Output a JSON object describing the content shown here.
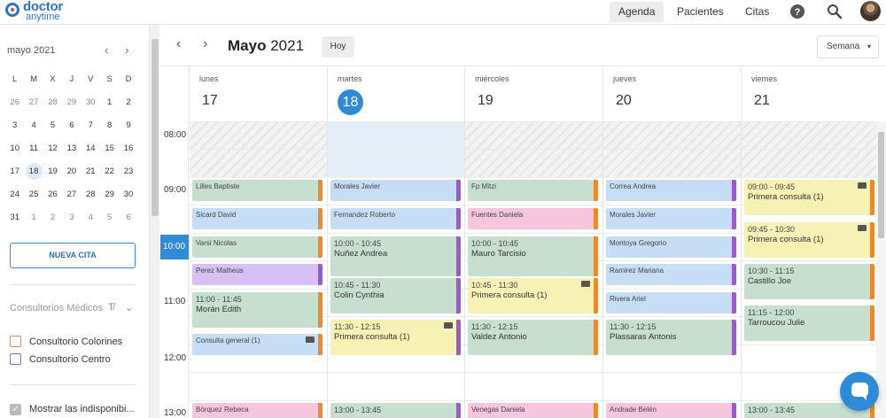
{
  "brand": {
    "line1": "doctor",
    "line2": "anytime"
  },
  "nav": [
    {
      "label": "Agenda",
      "active": true
    },
    {
      "label": "Pacientes",
      "active": false
    },
    {
      "label": "Citas",
      "active": false
    }
  ],
  "top_icons": [
    "help-icon",
    "search-icon",
    "user-avatar"
  ],
  "mini_calendar": {
    "title": "mayo 2021",
    "weekdays": [
      "L",
      "M",
      "X",
      "J",
      "V",
      "S",
      "D"
    ],
    "weeks": [
      [
        "26",
        "27",
        "28",
        "29",
        "30",
        "1",
        "2"
      ],
      [
        "3",
        "4",
        "5",
        "6",
        "7",
        "8",
        "9"
      ],
      [
        "10",
        "11",
        "12",
        "13",
        "14",
        "15",
        "16"
      ],
      [
        "17",
        "18",
        "19",
        "20",
        "21",
        "22",
        "23"
      ],
      [
        "24",
        "25",
        "26",
        "27",
        "28",
        "29",
        "30"
      ],
      [
        "31",
        "1",
        "2",
        "3",
        "4",
        "5",
        "6"
      ]
    ],
    "selected": "18"
  },
  "sidebar": {
    "new_button": "NUEVA CITA",
    "section_title": "Consultorios Médicos",
    "offices": [
      {
        "label": "Consultorio Colorines",
        "color": "#e88a2e"
      },
      {
        "label": "Consultorio Centro",
        "color": "#9a5ac8"
      }
    ],
    "show_unavailable": "Mostrar las indisponibi..."
  },
  "header": {
    "month": "Mayo",
    "year": "2021",
    "today_button": "Hoy",
    "view_select": "Semana"
  },
  "days": [
    {
      "name": "lunes",
      "num": "17",
      "today": false
    },
    {
      "name": "martes",
      "num": "18",
      "today": true
    },
    {
      "name": "miércoles",
      "num": "19",
      "today": false
    },
    {
      "name": "jueves",
      "num": "20",
      "today": false
    },
    {
      "name": "viernes",
      "num": "21",
      "today": false
    }
  ],
  "times": [
    "08:00",
    "09:00",
    "10:00",
    "11:00",
    "12:00",
    "13:00"
  ],
  "current_time_label": "10:00",
  "colors": {
    "green": "#c6dfcf",
    "blue": "#c6def5",
    "purple": "#d8c0f3",
    "pink": "#f6c5de",
    "yellow": "#f7f1b6",
    "orange_strip": "#e88a2e",
    "purple_strip": "#9a5ac8",
    "accent": "#2f8bd6"
  },
  "events": [
    {
      "day": 0,
      "t1": "Lilles Baptiste",
      "t2": "",
      "color": "green",
      "strip": "orange_strip"
    },
    {
      "day": 0,
      "t1": "Sicard David",
      "t2": "",
      "color": "blue",
      "strip": "orange_strip"
    },
    {
      "day": 0,
      "t1": "Varsi Nicolas",
      "t2": "",
      "color": "green",
      "strip": "orange_strip"
    },
    {
      "day": 0,
      "t1": "Perez Matheus",
      "t2": "",
      "color": "purple",
      "strip": "purple_strip"
    },
    {
      "day": 0,
      "t1": "11:00 - 11:45",
      "t2": "Morán Edith",
      "color": "green",
      "strip": "orange_strip",
      "big": true
    },
    {
      "day": 0,
      "t1": "Consulta general (1)",
      "t2": "",
      "color": "blue",
      "strip": "orange_strip",
      "mail": true
    },
    {
      "day": 0,
      "t1": "Bórquez Rebeca",
      "t2": "",
      "color": "pink",
      "strip": "orange_strip"
    },
    {
      "day": 1,
      "t1": "Morales Javier",
      "t2": "",
      "color": "blue",
      "strip": "purple_strip"
    },
    {
      "day": 1,
      "t1": "Fernandez Roberto",
      "t2": "",
      "color": "blue",
      "strip": "purple_strip"
    },
    {
      "day": 1,
      "t1": "10:00 - 10:45",
      "t2": "Nuñez Andrea",
      "color": "green",
      "strip": "purple_strip",
      "big": true
    },
    {
      "day": 1,
      "t1": "10:45 - 11:30",
      "t2": "Colin Cynthia",
      "color": "green",
      "strip": "purple_strip",
      "big": true
    },
    {
      "day": 1,
      "t1": "11:30 - 12:15",
      "t2": "Primera consulta (1)",
      "color": "yellow",
      "strip": "purple_strip",
      "big": true,
      "mail": true
    },
    {
      "day": 1,
      "t1": "13:00 - 13:45",
      "t2": "",
      "color": "green",
      "strip": "purple_strip",
      "big": true
    },
    {
      "day": 2,
      "t1": "Fp Mitzi",
      "t2": "",
      "color": "green",
      "strip": "orange_strip"
    },
    {
      "day": 2,
      "t1": "Fuentes Daniela",
      "t2": "",
      "color": "pink",
      "strip": "orange_strip"
    },
    {
      "day": 2,
      "t1": "10:00 - 10:45",
      "t2": "Mauro Tarcisio",
      "color": "green",
      "strip": "orange_strip",
      "big": true
    },
    {
      "day": 2,
      "t1": "10:45 - 11:30",
      "t2": "Primera consulta (1)",
      "color": "yellow",
      "strip": "orange_strip",
      "big": true,
      "mail": true
    },
    {
      "day": 2,
      "t1": "11:30 - 12:15",
      "t2": "Valdez Antonio",
      "color": "green",
      "strip": "orange_strip",
      "big": true
    },
    {
      "day": 2,
      "t1": "Venegas Daniela",
      "t2": "",
      "color": "pink",
      "strip": "orange_strip"
    },
    {
      "day": 3,
      "t1": "Correa Andrea",
      "t2": "",
      "color": "blue",
      "strip": "purple_strip"
    },
    {
      "day": 3,
      "t1": "Morales Javier",
      "t2": "",
      "color": "blue",
      "strip": "purple_strip"
    },
    {
      "day": 3,
      "t1": "Montoya Gregorio",
      "t2": "",
      "color": "blue",
      "strip": "purple_strip"
    },
    {
      "day": 3,
      "t1": "Ramirez Mariana",
      "t2": "",
      "color": "blue",
      "strip": "purple_strip"
    },
    {
      "day": 3,
      "t1": "Rivera Ariel",
      "t2": "",
      "color": "blue",
      "strip": "purple_strip"
    },
    {
      "day": 3,
      "t1": "11:30 - 12:15",
      "t2": "Plassaras Antonis",
      "color": "green",
      "strip": "purple_strip",
      "big": true
    },
    {
      "day": 3,
      "t1": "Andrade Belén",
      "t2": "",
      "color": "pink",
      "strip": "purple_strip"
    },
    {
      "day": 4,
      "t1": "09:00 - 09:45",
      "t2": "Primera consulta (1)",
      "color": "yellow",
      "strip": "orange_strip",
      "big": true,
      "mail": true
    },
    {
      "day": 4,
      "t1": "09:45 - 10:30",
      "t2": "Primera consulta (1)",
      "color": "yellow",
      "strip": "orange_strip",
      "big": true,
      "mail": true
    },
    {
      "day": 4,
      "t1": "10:30 - 11:15",
      "t2": "Castillo Joe",
      "color": "green",
      "strip": "orange_strip",
      "big": true
    },
    {
      "day": 4,
      "t1": "11:15 - 12:00",
      "t2": "Tarroucou Julie",
      "color": "green",
      "strip": "orange_strip",
      "big": true
    },
    {
      "day": 4,
      "t1": "13:00 - 13:45",
      "t2": "",
      "color": "green",
      "strip": "orange_strip",
      "big": true
    }
  ]
}
